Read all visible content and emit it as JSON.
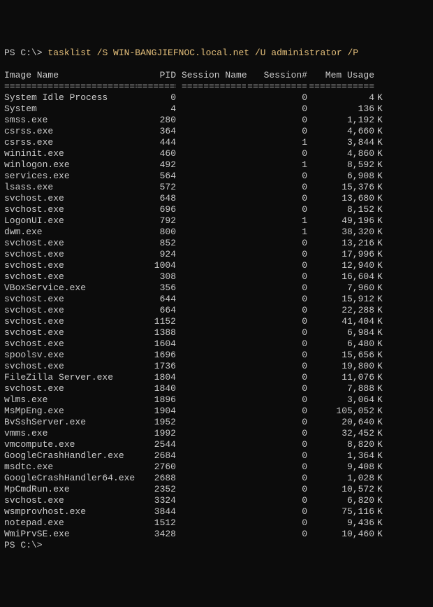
{
  "prompt1": {
    "prefix": "PS C:\\> ",
    "command": "tasklist",
    "args_yellow": " /S WIN-BANGJIEFNOC.local.net /U administrator /P",
    "args_plain_trail": " "
  },
  "prompt2": {
    "prefix": "PS C:\\>"
  },
  "headers": {
    "name": "Image Name",
    "pid": "PID",
    "sess_name": "Session Name",
    "sess_num": "Session#",
    "mem": "Mem Usage"
  },
  "separators": {
    "name": "=========================",
    "pid": "========",
    "sess_name": "================",
    "sess_num": "===========",
    "mem": "============"
  },
  "rows": [
    {
      "name": "System Idle Process",
      "pid": "0",
      "sess_name": "",
      "sess_num": "0",
      "mem": "4",
      "unit": "K"
    },
    {
      "name": "System",
      "pid": "4",
      "sess_name": "",
      "sess_num": "0",
      "mem": "136",
      "unit": "K"
    },
    {
      "name": "smss.exe",
      "pid": "280",
      "sess_name": "",
      "sess_num": "0",
      "mem": "1,192",
      "unit": "K"
    },
    {
      "name": "csrss.exe",
      "pid": "364",
      "sess_name": "",
      "sess_num": "0",
      "mem": "4,660",
      "unit": "K"
    },
    {
      "name": "csrss.exe",
      "pid": "444",
      "sess_name": "",
      "sess_num": "1",
      "mem": "3,844",
      "unit": "K"
    },
    {
      "name": "wininit.exe",
      "pid": "460",
      "sess_name": "",
      "sess_num": "0",
      "mem": "4,860",
      "unit": "K"
    },
    {
      "name": "winlogon.exe",
      "pid": "492",
      "sess_name": "",
      "sess_num": "1",
      "mem": "8,592",
      "unit": "K"
    },
    {
      "name": "services.exe",
      "pid": "564",
      "sess_name": "",
      "sess_num": "0",
      "mem": "6,908",
      "unit": "K"
    },
    {
      "name": "lsass.exe",
      "pid": "572",
      "sess_name": "",
      "sess_num": "0",
      "mem": "15,376",
      "unit": "K"
    },
    {
      "name": "svchost.exe",
      "pid": "648",
      "sess_name": "",
      "sess_num": "0",
      "mem": "13,680",
      "unit": "K"
    },
    {
      "name": "svchost.exe",
      "pid": "696",
      "sess_name": "",
      "sess_num": "0",
      "mem": "8,152",
      "unit": "K"
    },
    {
      "name": "LogonUI.exe",
      "pid": "792",
      "sess_name": "",
      "sess_num": "1",
      "mem": "49,196",
      "unit": "K"
    },
    {
      "name": "dwm.exe",
      "pid": "800",
      "sess_name": "",
      "sess_num": "1",
      "mem": "38,320",
      "unit": "K"
    },
    {
      "name": "svchost.exe",
      "pid": "852",
      "sess_name": "",
      "sess_num": "0",
      "mem": "13,216",
      "unit": "K"
    },
    {
      "name": "svchost.exe",
      "pid": "924",
      "sess_name": "",
      "sess_num": "0",
      "mem": "17,996",
      "unit": "K"
    },
    {
      "name": "svchost.exe",
      "pid": "1004",
      "sess_name": "",
      "sess_num": "0",
      "mem": "12,940",
      "unit": "K"
    },
    {
      "name": "svchost.exe",
      "pid": "308",
      "sess_name": "",
      "sess_num": "0",
      "mem": "16,604",
      "unit": "K"
    },
    {
      "name": "VBoxService.exe",
      "pid": "356",
      "sess_name": "",
      "sess_num": "0",
      "mem": "7,960",
      "unit": "K"
    },
    {
      "name": "svchost.exe",
      "pid": "644",
      "sess_name": "",
      "sess_num": "0",
      "mem": "15,912",
      "unit": "K"
    },
    {
      "name": "svchost.exe",
      "pid": "664",
      "sess_name": "",
      "sess_num": "0",
      "mem": "22,288",
      "unit": "K"
    },
    {
      "name": "svchost.exe",
      "pid": "1152",
      "sess_name": "",
      "sess_num": "0",
      "mem": "41,404",
      "unit": "K"
    },
    {
      "name": "svchost.exe",
      "pid": "1388",
      "sess_name": "",
      "sess_num": "0",
      "mem": "6,984",
      "unit": "K"
    },
    {
      "name": "svchost.exe",
      "pid": "1604",
      "sess_name": "",
      "sess_num": "0",
      "mem": "6,480",
      "unit": "K"
    },
    {
      "name": "spoolsv.exe",
      "pid": "1696",
      "sess_name": "",
      "sess_num": "0",
      "mem": "15,656",
      "unit": "K"
    },
    {
      "name": "svchost.exe",
      "pid": "1736",
      "sess_name": "",
      "sess_num": "0",
      "mem": "19,800",
      "unit": "K"
    },
    {
      "name": "FileZilla Server.exe",
      "pid": "1804",
      "sess_name": "",
      "sess_num": "0",
      "mem": "11,076",
      "unit": "K"
    },
    {
      "name": "svchost.exe",
      "pid": "1840",
      "sess_name": "",
      "sess_num": "0",
      "mem": "7,888",
      "unit": "K"
    },
    {
      "name": "wlms.exe",
      "pid": "1896",
      "sess_name": "",
      "sess_num": "0",
      "mem": "3,064",
      "unit": "K"
    },
    {
      "name": "MsMpEng.exe",
      "pid": "1904",
      "sess_name": "",
      "sess_num": "0",
      "mem": "105,052",
      "unit": "K"
    },
    {
      "name": "BvSshServer.exe",
      "pid": "1952",
      "sess_name": "",
      "sess_num": "0",
      "mem": "20,640",
      "unit": "K"
    },
    {
      "name": "vmms.exe",
      "pid": "1992",
      "sess_name": "",
      "sess_num": "0",
      "mem": "32,452",
      "unit": "K"
    },
    {
      "name": "vmcompute.exe",
      "pid": "2544",
      "sess_name": "",
      "sess_num": "0",
      "mem": "8,820",
      "unit": "K"
    },
    {
      "name": "GoogleCrashHandler.exe",
      "pid": "2684",
      "sess_name": "",
      "sess_num": "0",
      "mem": "1,364",
      "unit": "K"
    },
    {
      "name": "msdtc.exe",
      "pid": "2760",
      "sess_name": "",
      "sess_num": "0",
      "mem": "9,408",
      "unit": "K"
    },
    {
      "name": "GoogleCrashHandler64.exe",
      "pid": "2688",
      "sess_name": "",
      "sess_num": "0",
      "mem": "1,028",
      "unit": "K"
    },
    {
      "name": "MpCmdRun.exe",
      "pid": "2352",
      "sess_name": "",
      "sess_num": "0",
      "mem": "10,572",
      "unit": "K"
    },
    {
      "name": "svchost.exe",
      "pid": "3324",
      "sess_name": "",
      "sess_num": "0",
      "mem": "6,820",
      "unit": "K"
    },
    {
      "name": "wsmprovhost.exe",
      "pid": "3844",
      "sess_name": "",
      "sess_num": "0",
      "mem": "75,116",
      "unit": "K"
    },
    {
      "name": "notepad.exe",
      "pid": "1512",
      "sess_name": "",
      "sess_num": "0",
      "mem": "9,436",
      "unit": "K"
    },
    {
      "name": "WmiPrvSE.exe",
      "pid": "3428",
      "sess_name": "",
      "sess_num": "0",
      "mem": "10,460",
      "unit": "K"
    }
  ]
}
